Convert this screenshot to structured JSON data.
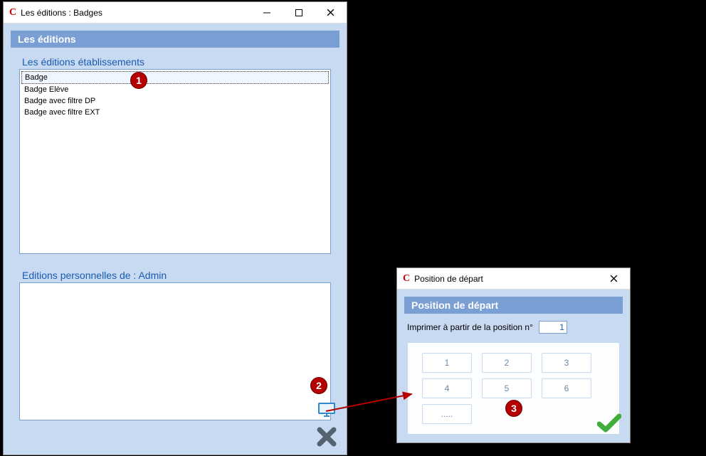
{
  "window1": {
    "title": "Les éditions : Badges",
    "panel_title": "Les éditions",
    "section1_label": "Les éditions établissements",
    "list1": [
      "Badge",
      "Badge Elève",
      "Badge avec filtre DP",
      "Badge avec filtre EXT"
    ],
    "section2_label": "Editions personnelles de : Admin"
  },
  "window2": {
    "title": "Position de départ",
    "panel_title": "Position de départ",
    "field_label": "Imprimer à partir de la position n°",
    "field_value": "1",
    "grid": [
      "1",
      "2",
      "3",
      "4",
      "5",
      "6",
      "....."
    ]
  },
  "markers": {
    "m1": "1",
    "m2": "2",
    "m3": "3"
  }
}
